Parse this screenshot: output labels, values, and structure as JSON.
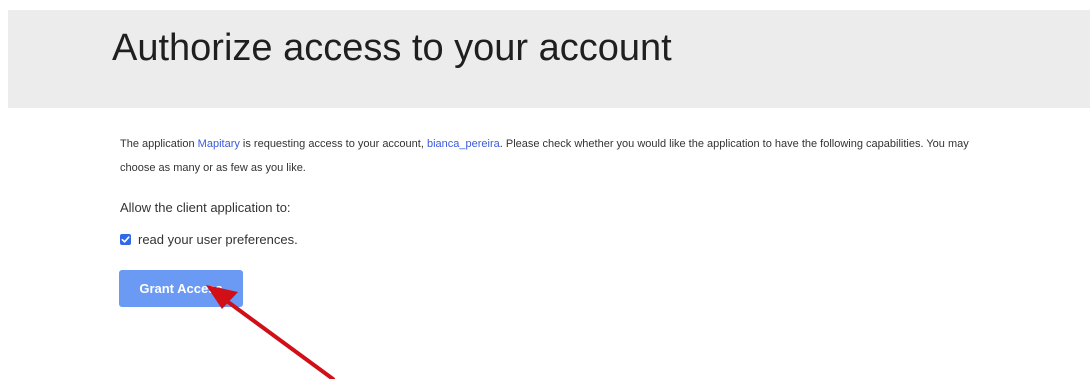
{
  "header": {
    "title": "Authorize access to your account"
  },
  "intro": {
    "text_1": "The application ",
    "app_name": "Mapitary",
    "text_2": " is requesting access to your account, ",
    "username": "bianca_pereira",
    "text_3": ". Please check whether you would like the application to have the following capabilities. You may choose as many or as few as you like."
  },
  "permissions": {
    "label": "Allow the client application to:",
    "items": [
      {
        "label": "read your user preferences.",
        "checked": true
      }
    ]
  },
  "actions": {
    "grant_label": "Grant Access"
  },
  "colors": {
    "header_bg": "#ececec",
    "link": "#3a5ad9",
    "button_bg": "#6b9af5",
    "arrow": "#d10f17"
  },
  "icons": {
    "checkbox": "checkbox-checked-icon",
    "arrow": "red-pointer-arrow-icon"
  }
}
